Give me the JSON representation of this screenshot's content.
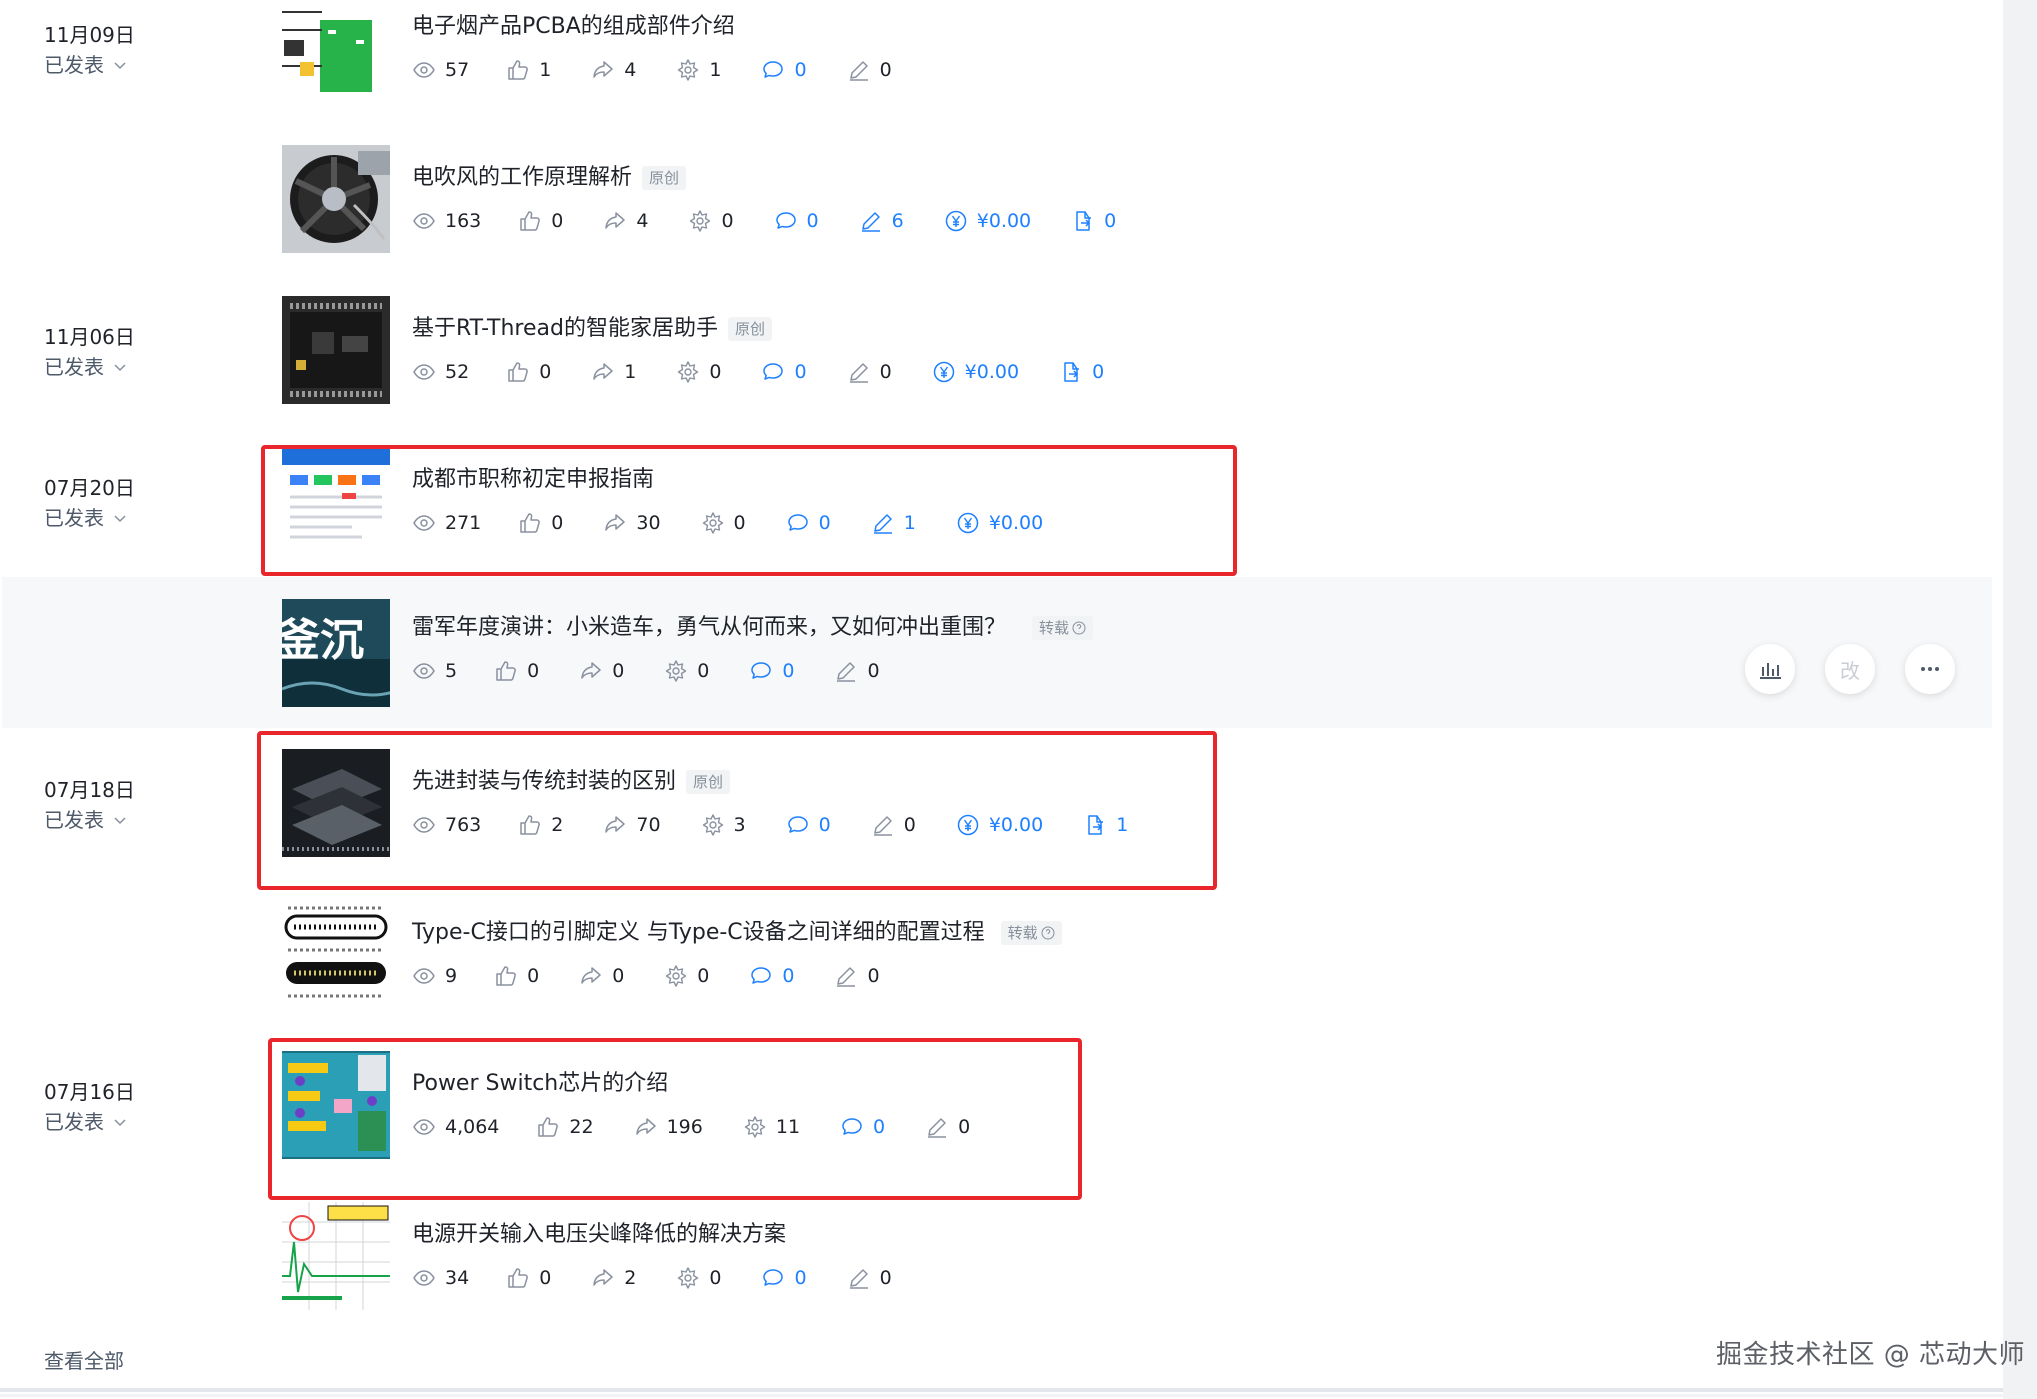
{
  "articles": [
    {
      "date": "11月09日",
      "status": "已发表",
      "title": "电子烟产品PCBA的组成部件介绍",
      "tag": "",
      "stats": {
        "views": "57",
        "likes": "1",
        "shares": "4",
        "collects": "1",
        "comments": "0",
        "edits": "0",
        "income": "",
        "exports": ""
      }
    },
    {
      "date": "",
      "status": "",
      "title": "电吹风的工作原理解析",
      "tag": "原创",
      "stats": {
        "views": "163",
        "likes": "0",
        "shares": "4",
        "collects": "0",
        "comments": "0",
        "edits": "6",
        "income": "¥0.00",
        "exports": "0"
      }
    },
    {
      "date": "11月06日",
      "status": "已发表",
      "title": "基于RT-Thread的智能家居助手",
      "tag": "原创",
      "stats": {
        "views": "52",
        "likes": "0",
        "shares": "1",
        "collects": "0",
        "comments": "0",
        "edits": "0",
        "income": "¥0.00",
        "exports": "0"
      }
    },
    {
      "date": "07月20日",
      "status": "已发表",
      "title": "成都市职称初定申报指南",
      "tag": "",
      "stats": {
        "views": "271",
        "likes": "0",
        "shares": "30",
        "collects": "0",
        "comments": "0",
        "edits": "1",
        "income": "¥0.00",
        "exports": ""
      }
    },
    {
      "date": "",
      "status": "",
      "title": "雷军年度演讲：小米造车，勇气从何而来，又如何冲出重围？",
      "tag": "转载",
      "stats": {
        "views": "5",
        "likes": "0",
        "shares": "0",
        "collects": "0",
        "comments": "0",
        "edits": "0",
        "income": "",
        "exports": ""
      }
    },
    {
      "date": "07月18日",
      "status": "已发表",
      "title": "先进封装与传统封装的区别",
      "tag": "原创",
      "stats": {
        "views": "763",
        "likes": "2",
        "shares": "70",
        "collects": "3",
        "comments": "0",
        "edits": "0",
        "income": "¥0.00",
        "exports": "1"
      }
    },
    {
      "date": "",
      "status": "",
      "title": "Type-C接口的引脚定义 与Type-C设备之间详细的配置过程",
      "tag": "转载",
      "stats": {
        "views": "9",
        "likes": "0",
        "shares": "0",
        "collects": "0",
        "comments": "0",
        "edits": "0",
        "income": "",
        "exports": ""
      }
    },
    {
      "date": "07月16日",
      "status": "已发表",
      "title": "Power Switch芯片的介绍",
      "tag": "",
      "stats": {
        "views": "4,064",
        "likes": "22",
        "shares": "196",
        "collects": "11",
        "comments": "0",
        "edits": "0",
        "income": "",
        "exports": ""
      }
    },
    {
      "date": "",
      "status": "",
      "title": "电源开关输入电压尖峰降低的解决方案",
      "tag": "",
      "stats": {
        "views": "34",
        "likes": "0",
        "shares": "2",
        "collects": "0",
        "comments": "0",
        "edits": "0",
        "income": "",
        "exports": ""
      }
    }
  ],
  "hover_actions": {
    "edit_label": "改"
  },
  "footer": {
    "view_all": "查看全部",
    "watermark": "掘金技术社区 @ 芯动大师"
  },
  "colors": {
    "highlight": "#e8262c",
    "accent": "#1e80ff",
    "hover_bg": "#f7f8fa"
  },
  "icons": [
    "eye-icon",
    "thumb-up-icon",
    "share-icon",
    "collect-icon",
    "comment-icon",
    "pen-icon",
    "yuan-icon",
    "export-icon",
    "chevron-down-icon",
    "question-icon",
    "chart-icon",
    "more-icon"
  ]
}
